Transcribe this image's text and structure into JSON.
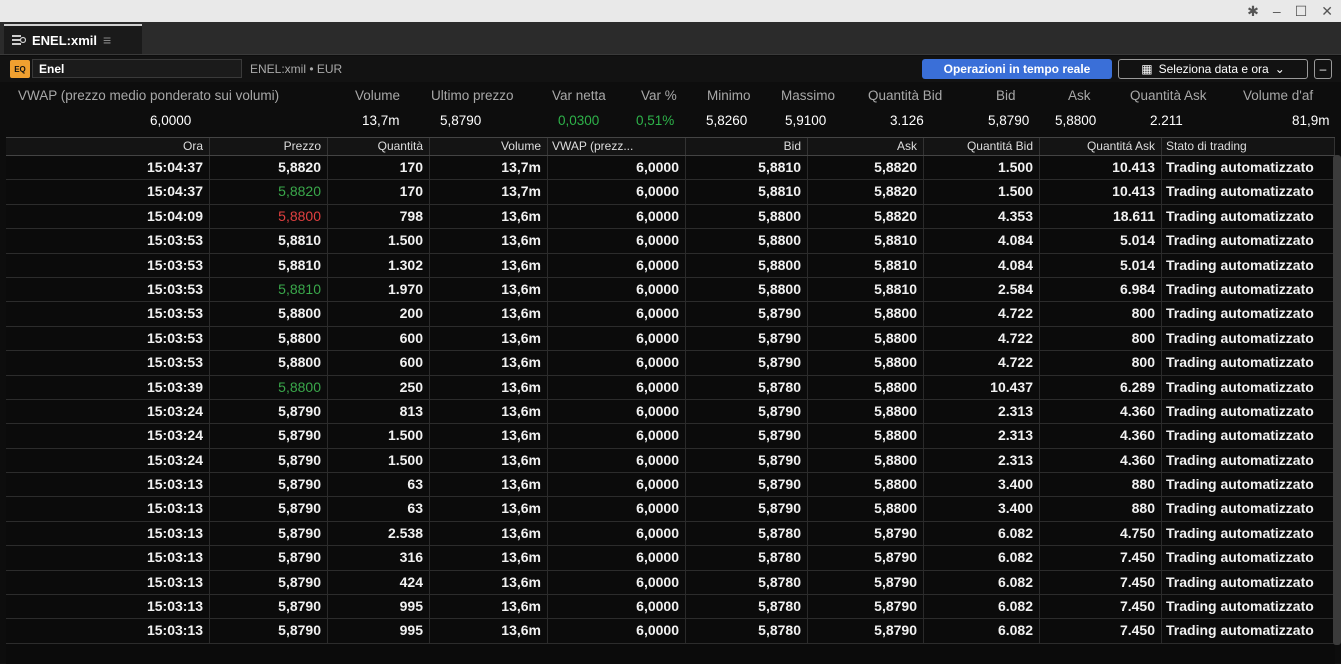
{
  "window": {
    "controls": [
      "✱",
      "–",
      "☐",
      "✕"
    ]
  },
  "tab": {
    "title": "ENEL:xmil"
  },
  "toolbar": {
    "eq_badge": "EQ",
    "symbol_value": "Enel",
    "symbol_meta": "ENEL:xmil • EUR",
    "realtime_label": "Operazioni in tempo reale",
    "date_label": "Seleziona data e ora",
    "minus_label": "–"
  },
  "summary": {
    "headers": [
      "VWAP (prezzo medio ponderato sui volumi)",
      "Volume",
      "Ultimo prezzo",
      "Var netta",
      "Var %",
      "Minimo",
      "Massimo",
      "Quantità Bid",
      "Bid",
      "Ask",
      "Quantità Ask",
      "Volume d'af"
    ],
    "values": [
      "6,0000",
      "13,7m",
      "5,8790",
      "0,0300",
      "0,51%",
      "5,8260",
      "5,9100",
      "3.126",
      "5,8790",
      "5,8800",
      "2.211",
      "81,9m"
    ],
    "positive_color": "#2eb34a"
  },
  "table": {
    "columns": [
      "Ora",
      "Prezzo",
      "Quantità",
      "Volume",
      "VWAP (prezz...",
      "Bid",
      "Ask",
      "Quantitá Bid",
      "Quantitá Ask",
      "Stato di trading"
    ],
    "rows": [
      [
        "15:04:37",
        "5,8820",
        "170",
        "13,7m",
        "6,0000",
        "5,8810",
        "5,8820",
        "1.500",
        "10.413",
        "Trading automatizzato"
      ],
      [
        "15:04:37",
        "5,8820",
        "170",
        "13,7m",
        "6,0000",
        "5,8810",
        "5,8820",
        "1.500",
        "10.413",
        "Trading automatizzato"
      ],
      [
        "15:04:09",
        "5,8800",
        "798",
        "13,6m",
        "6,0000",
        "5,8800",
        "5,8820",
        "4.353",
        "18.611",
        "Trading automatizzato"
      ],
      [
        "15:03:53",
        "5,8810",
        "1.500",
        "13,6m",
        "6,0000",
        "5,8800",
        "5,8810",
        "4.084",
        "5.014",
        "Trading automatizzato"
      ],
      [
        "15:03:53",
        "5,8810",
        "1.302",
        "13,6m",
        "6,0000",
        "5,8800",
        "5,8810",
        "4.084",
        "5.014",
        "Trading automatizzato"
      ],
      [
        "15:03:53",
        "5,8810",
        "1.970",
        "13,6m",
        "6,0000",
        "5,8800",
        "5,8810",
        "2.584",
        "6.984",
        "Trading automatizzato"
      ],
      [
        "15:03:53",
        "5,8800",
        "200",
        "13,6m",
        "6,0000",
        "5,8790",
        "5,8800",
        "4.722",
        "800",
        "Trading automatizzato"
      ],
      [
        "15:03:53",
        "5,8800",
        "600",
        "13,6m",
        "6,0000",
        "5,8790",
        "5,8800",
        "4.722",
        "800",
        "Trading automatizzato"
      ],
      [
        "15:03:53",
        "5,8800",
        "600",
        "13,6m",
        "6,0000",
        "5,8790",
        "5,8800",
        "4.722",
        "800",
        "Trading automatizzato"
      ],
      [
        "15:03:39",
        "5,8800",
        "250",
        "13,6m",
        "6,0000",
        "5,8780",
        "5,8800",
        "10.437",
        "6.289",
        "Trading automatizzato"
      ],
      [
        "15:03:24",
        "5,8790",
        "813",
        "13,6m",
        "6,0000",
        "5,8790",
        "5,8800",
        "2.313",
        "4.360",
        "Trading automatizzato"
      ],
      [
        "15:03:24",
        "5,8790",
        "1.500",
        "13,6m",
        "6,0000",
        "5,8790",
        "5,8800",
        "2.313",
        "4.360",
        "Trading automatizzato"
      ],
      [
        "15:03:24",
        "5,8790",
        "1.500",
        "13,6m",
        "6,0000",
        "5,8790",
        "5,8800",
        "2.313",
        "4.360",
        "Trading automatizzato"
      ],
      [
        "15:03:13",
        "5,8790",
        "63",
        "13,6m",
        "6,0000",
        "5,8790",
        "5,8800",
        "3.400",
        "880",
        "Trading automatizzato"
      ],
      [
        "15:03:13",
        "5,8790",
        "63",
        "13,6m",
        "6,0000",
        "5,8790",
        "5,8800",
        "3.400",
        "880",
        "Trading automatizzato"
      ],
      [
        "15:03:13",
        "5,8790",
        "2.538",
        "13,6m",
        "6,0000",
        "5,8780",
        "5,8790",
        "6.082",
        "4.750",
        "Trading automatizzato"
      ],
      [
        "15:03:13",
        "5,8790",
        "316",
        "13,6m",
        "6,0000",
        "5,8780",
        "5,8790",
        "6.082",
        "7.450",
        "Trading automatizzato"
      ],
      [
        "15:03:13",
        "5,8790",
        "424",
        "13,6m",
        "6,0000",
        "5,8780",
        "5,8790",
        "6.082",
        "7.450",
        "Trading automatizzato"
      ],
      [
        "15:03:13",
        "5,8790",
        "995",
        "13,6m",
        "6,0000",
        "5,8780",
        "5,8790",
        "6.082",
        "7.450",
        "Trading automatizzato"
      ],
      [
        "15:03:13",
        "5,8790",
        "995",
        "13,6m",
        "6,0000",
        "5,8780",
        "5,8790",
        "6.082",
        "7.450",
        "Trading automatizzato"
      ]
    ],
    "price_tick": [
      "",
      "up",
      "down",
      "",
      "",
      "up",
      "",
      "",
      "",
      "up",
      "",
      "",
      "",
      "",
      "",
      "",
      "",
      "",
      "",
      ""
    ],
    "colors": {
      "up": "#3aa84b",
      "down": "#e04040"
    }
  }
}
